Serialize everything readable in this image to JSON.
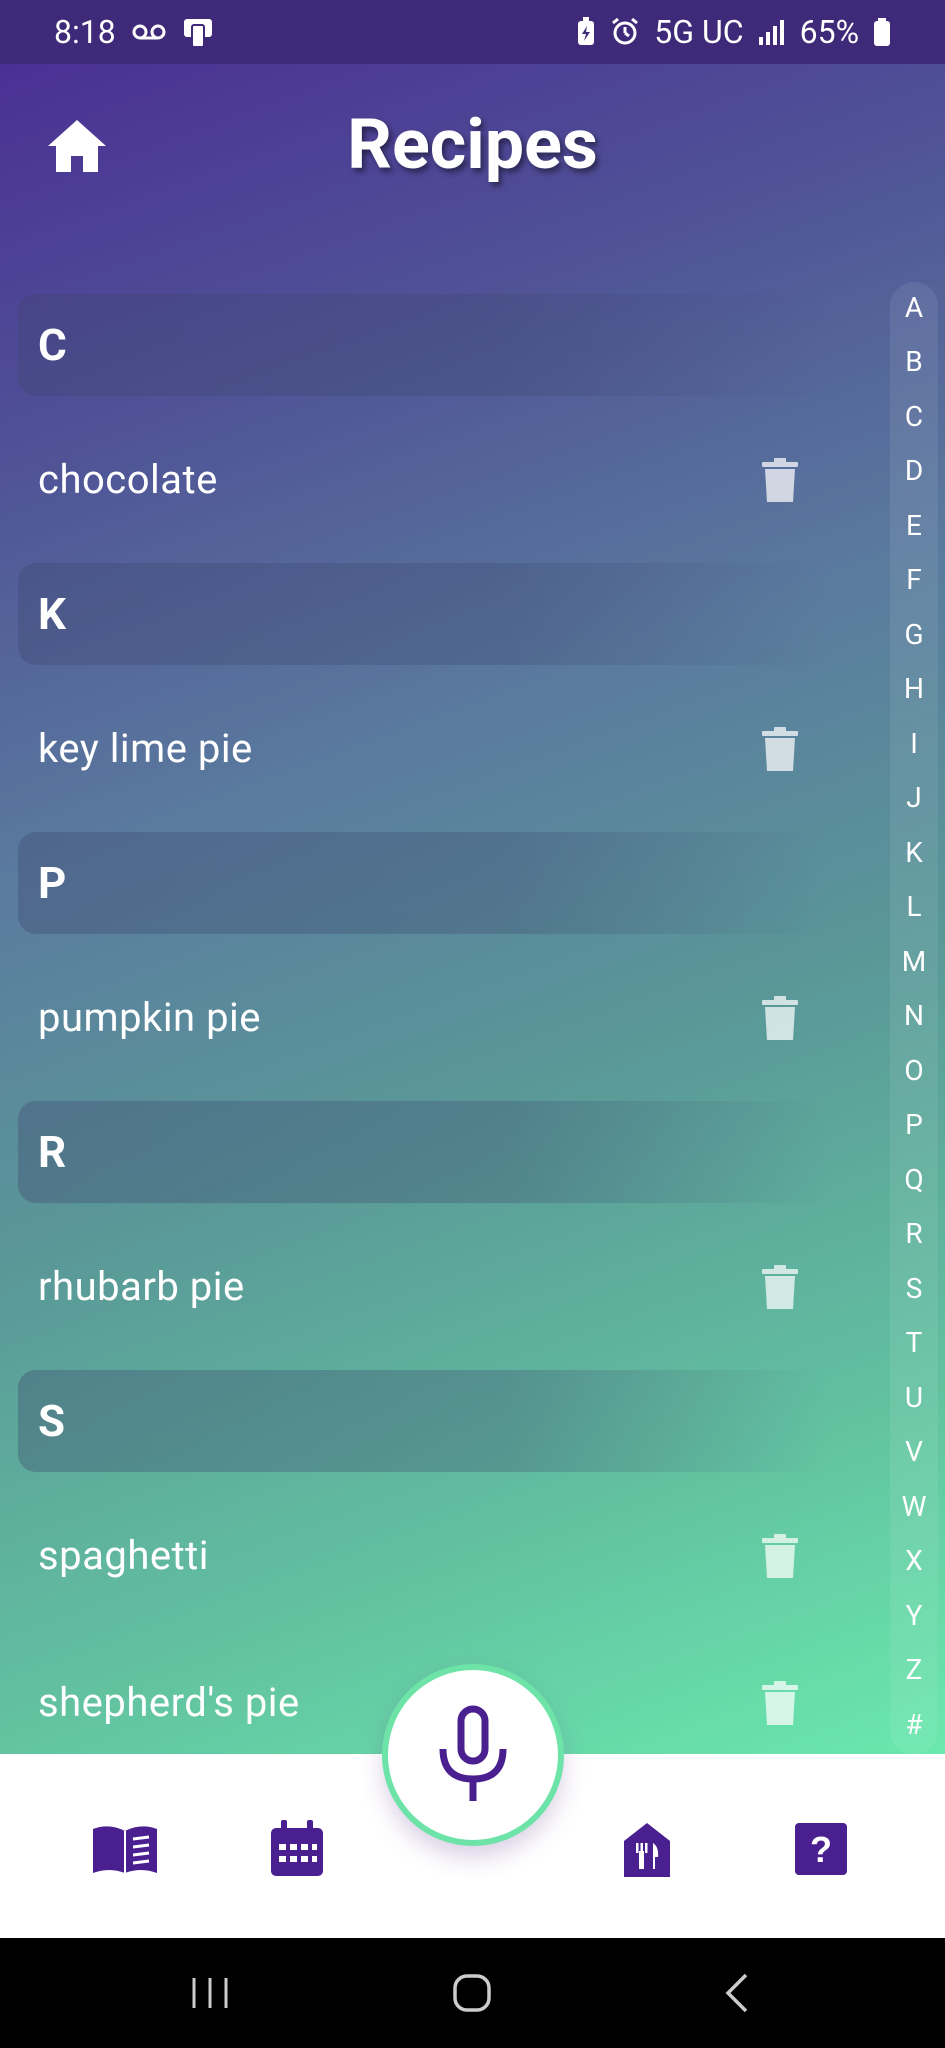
{
  "status_bar": {
    "time": "8:18",
    "network": "5G UC",
    "battery": "65%",
    "left_icons": [
      "voicemail-icon",
      "screen-icon"
    ],
    "right_icons": [
      "battery-saver-icon",
      "alarm-icon",
      "signal-icon",
      "battery-icon"
    ]
  },
  "header": {
    "title": "Recipes",
    "home_icon": "home-icon"
  },
  "sections": [
    {
      "letter": "C",
      "recipes": [
        "chocolate"
      ]
    },
    {
      "letter": "K",
      "recipes": [
        "key lime pie"
      ]
    },
    {
      "letter": "P",
      "recipes": [
        "pumpkin pie"
      ]
    },
    {
      "letter": "R",
      "recipes": [
        "rhubarb pie"
      ]
    },
    {
      "letter": "S",
      "recipes": [
        "spaghetti",
        "shepherd's pie"
      ]
    }
  ],
  "alphabet_index": [
    "A",
    "B",
    "C",
    "D",
    "E",
    "F",
    "G",
    "H",
    "I",
    "J",
    "K",
    "L",
    "M",
    "N",
    "O",
    "P",
    "Q",
    "R",
    "S",
    "T",
    "U",
    "V",
    "W",
    "X",
    "Y",
    "Z",
    "#"
  ],
  "bottom_nav": {
    "items": [
      "book-icon",
      "calendar-icon",
      "microphone-icon",
      "restaurant-icon",
      "help-icon"
    ]
  },
  "colors": {
    "accent": "#4a1f8f",
    "fab_ring": "#6ee3a8",
    "gradient_top": "#4a2a94",
    "gradient_bottom": "#6ae8ad"
  }
}
